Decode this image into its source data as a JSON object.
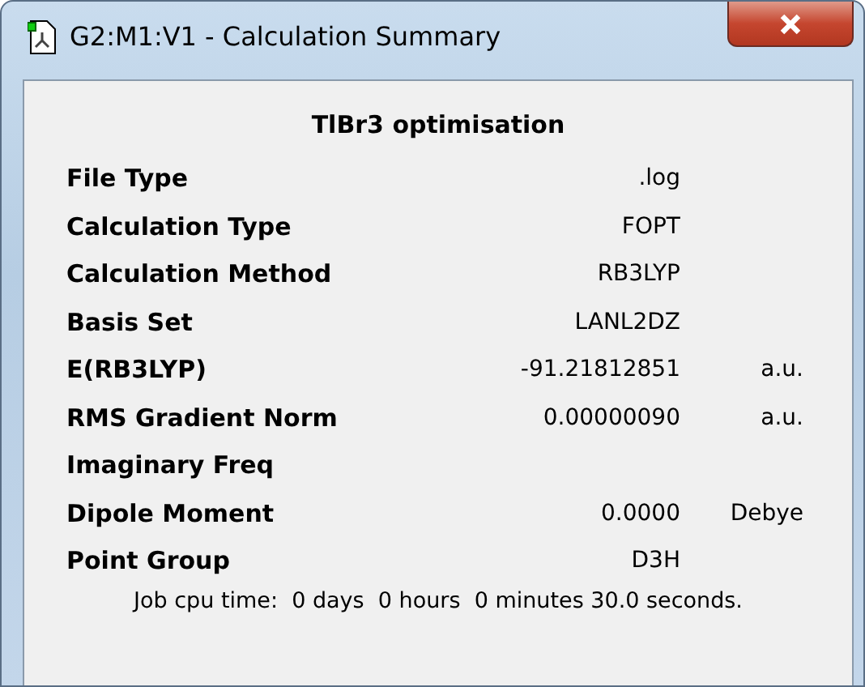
{
  "window": {
    "title": "G2:M1:V1 - Calculation Summary"
  },
  "heading": "TlBr3 optimisation",
  "rows": [
    {
      "label": "File Type",
      "value": ".log"
    },
    {
      "label": "Calculation Type",
      "value": "FOPT"
    },
    {
      "label": "Calculation Method",
      "value": "RB3LYP"
    },
    {
      "label": "Basis Set",
      "value": "LANL2DZ"
    },
    {
      "label": "E(RB3LYP)",
      "value": "-91.21812851",
      "unit": "a.u."
    },
    {
      "label": "RMS Gradient Norm",
      "value": "0.00000090",
      "unit": "a.u."
    },
    {
      "label": "Imaginary Freq"
    },
    {
      "label": "Dipole Moment",
      "value": "0.0000",
      "unit": "Debye"
    },
    {
      "label": "Point Group",
      "value": "D3H"
    }
  ],
  "footer": "Job cpu time:  0 days  0 hours  0 minutes 30.0 seconds."
}
